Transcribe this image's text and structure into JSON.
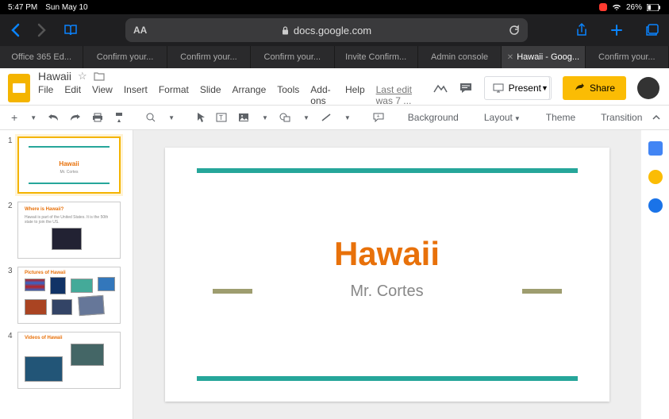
{
  "status": {
    "time": "5:47 PM",
    "date": "Sun May 10",
    "battery": "26%"
  },
  "safari": {
    "url": "docs.google.com",
    "aa": "AA"
  },
  "tabs": [
    {
      "label": "Office 365 Ed..."
    },
    {
      "label": "Confirm your..."
    },
    {
      "label": "Confirm your..."
    },
    {
      "label": "Confirm your..."
    },
    {
      "label": "Invite Confirm..."
    },
    {
      "label": "Admin console"
    },
    {
      "label": "Hawaii - Goog...",
      "active": true
    },
    {
      "label": "Confirm your..."
    }
  ],
  "doc": {
    "title": "Hawaii",
    "menus": [
      "File",
      "Edit",
      "View",
      "Insert",
      "Format",
      "Slide",
      "Arrange",
      "Tools",
      "Add-ons",
      "Help"
    ],
    "last_edit": "Last edit was 7 ...",
    "present": "Present",
    "share": "Share"
  },
  "toolbar": {
    "background": "Background",
    "layout": "Layout",
    "theme": "Theme",
    "transition": "Transition"
  },
  "slides": [
    {
      "n": "1",
      "title": "Hawaii",
      "sub": "Mr. Cortes"
    },
    {
      "n": "2",
      "title": "Where is Hawaii?"
    },
    {
      "n": "3",
      "title": "Pictures of Hawaii"
    },
    {
      "n": "4",
      "title": "Videos of Hawaii"
    }
  ],
  "canvas": {
    "title": "Hawaii",
    "sub": "Mr. Cortes"
  }
}
